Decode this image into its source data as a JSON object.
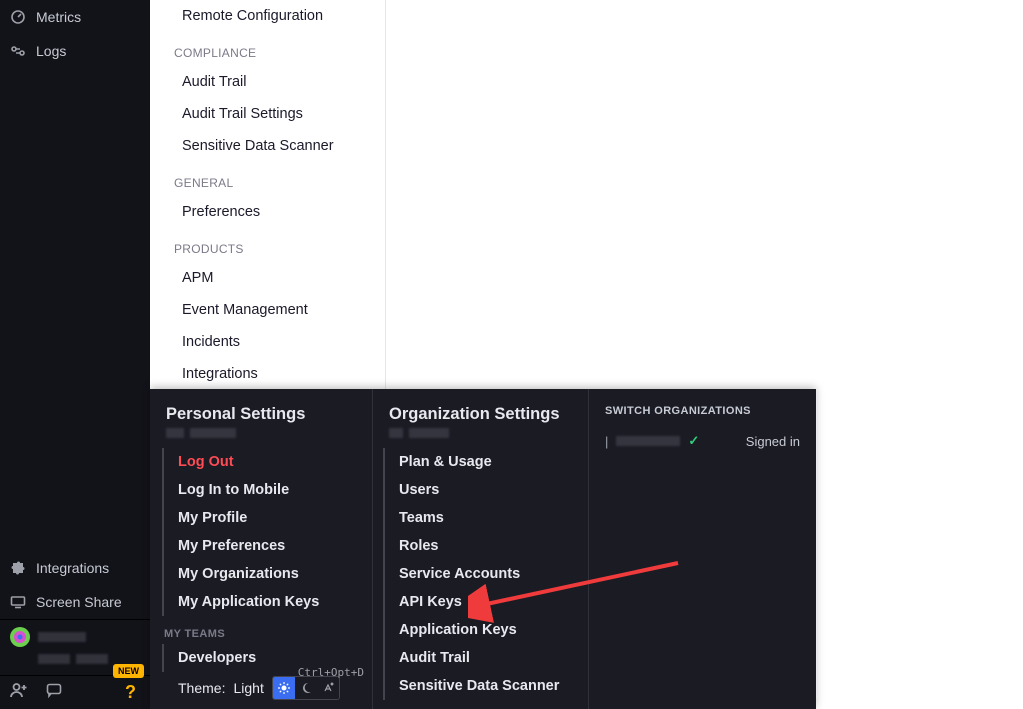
{
  "leftNav": {
    "top": [
      {
        "label": "Metrics",
        "icon": "metrics"
      },
      {
        "label": "Logs",
        "icon": "logs"
      }
    ],
    "bottom": [
      {
        "label": "Integrations",
        "icon": "puzzle"
      },
      {
        "label": "Screen Share",
        "icon": "screen"
      }
    ],
    "newBadge": "NEW"
  },
  "secondary": {
    "items0": [
      "Remote Configuration"
    ],
    "sectionCompliance": "COMPLIANCE",
    "itemsCompliance": [
      "Audit Trail",
      "Audit Trail Settings",
      "Sensitive Data Scanner"
    ],
    "sectionGeneral": "GENERAL",
    "itemsGeneral": [
      "Preferences"
    ],
    "sectionProducts": "PRODUCTS",
    "itemsProducts": [
      "APM",
      "Event Management",
      "Incidents",
      "Integrations"
    ]
  },
  "popup": {
    "personal": {
      "title": "Personal Settings",
      "items": [
        "Log Out",
        "Log In to Mobile",
        "My Profile",
        "My Preferences",
        "My Organizations",
        "My Application Keys"
      ],
      "teamsLabel": "MY TEAMS",
      "teams": [
        "Developers"
      ],
      "kbd": "Ctrl+Opt+D",
      "themeLabel": "Theme:",
      "themeValue": "Light"
    },
    "org": {
      "title": "Organization Settings",
      "items": [
        "Plan & Usage",
        "Users",
        "Teams",
        "Roles",
        "Service Accounts",
        "API Keys",
        "Application Keys",
        "Audit Trail",
        "Sensitive Data Scanner"
      ]
    },
    "switch": {
      "title": "SWITCH ORGANIZATIONS",
      "signedIn": "Signed in"
    }
  }
}
